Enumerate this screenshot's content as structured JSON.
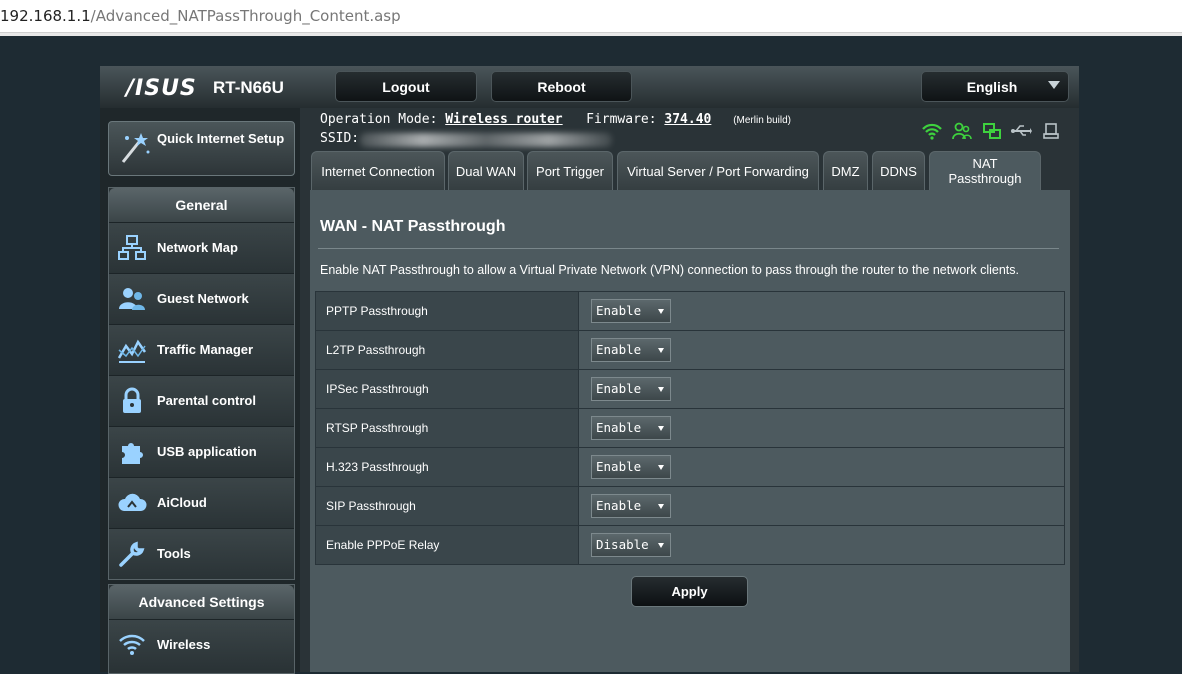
{
  "browser": {
    "url_host": "192.168.1.1",
    "url_path": "/Advanced_NATPassThrough_Content.asp"
  },
  "header": {
    "brand": "/ISUS",
    "model": "RT-N66U",
    "logout_label": "Logout",
    "reboot_label": "Reboot",
    "language": "English"
  },
  "info": {
    "operation_mode_label": "Operation Mode:",
    "operation_mode_value": "Wireless router",
    "firmware_label": "Firmware:",
    "firmware_value": "374.40",
    "build_note": "(Merlin build)",
    "ssid_label": "SSID:"
  },
  "sidebar": {
    "quick_setup": "Quick Internet Setup",
    "general_header": "General",
    "general_items": [
      {
        "label": "Network Map",
        "icon": "network-map-icon"
      },
      {
        "label": "Guest Network",
        "icon": "guest-network-icon"
      },
      {
        "label": "Traffic Manager",
        "icon": "traffic-manager-icon"
      },
      {
        "label": "Parental control",
        "icon": "lock-icon"
      },
      {
        "label": "USB application",
        "icon": "puzzle-icon"
      },
      {
        "label": "AiCloud",
        "icon": "cloud-icon"
      },
      {
        "label": "Tools",
        "icon": "wrench-icon"
      }
    ],
    "advanced_header": "Advanced Settings",
    "advanced_items": [
      {
        "label": "Wireless",
        "icon": "wifi-icon"
      }
    ]
  },
  "tabs": [
    {
      "label": "Internet Connection"
    },
    {
      "label": "Dual WAN"
    },
    {
      "label": "Port Trigger"
    },
    {
      "label": "Virtual Server / Port Forwarding"
    },
    {
      "label": "DMZ"
    },
    {
      "label": "DDNS"
    },
    {
      "label": "NAT Passthrough",
      "active": true
    }
  ],
  "main": {
    "title": "WAN - NAT Passthrough",
    "description": "Enable NAT Passthrough to allow a Virtual Private Network (VPN) connection to pass through the router to the network clients.",
    "rows": [
      {
        "label": "PPTP Passthrough",
        "value": "Enable"
      },
      {
        "label": "L2TP Passthrough",
        "value": "Enable"
      },
      {
        "label": "IPSec Passthrough",
        "value": "Enable"
      },
      {
        "label": "RTSP Passthrough",
        "value": "Enable"
      },
      {
        "label": "H.323 Passthrough",
        "value": "Enable"
      },
      {
        "label": "SIP Passthrough",
        "value": "Enable"
      },
      {
        "label": "Enable PPPoE Relay",
        "value": "Disable"
      }
    ],
    "apply_label": "Apply"
  },
  "colors": {
    "status_green": "#3ed23e",
    "status_grey": "#b9c3c7"
  }
}
